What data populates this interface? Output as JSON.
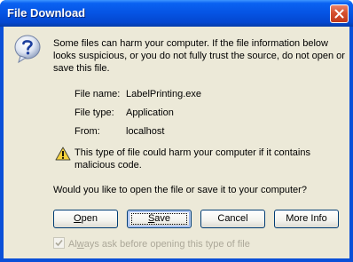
{
  "window": {
    "title": "File Download"
  },
  "icons": {
    "close": "close-icon",
    "question": "question-icon",
    "warning": "warning-icon",
    "checkmark": "checkmark-icon"
  },
  "message": {
    "intro": "Some files can harm your computer. If the file information below looks suspicious, or you do not fully trust the source, do not open or save this file."
  },
  "file_info": {
    "name_label": "File name:",
    "name_value": "LabelPrinting.exe",
    "type_label": "File type:",
    "type_value": "Application",
    "from_label": "From:",
    "from_value": "localhost"
  },
  "warning": {
    "text": "This type of file could harm your computer if it contains malicious code."
  },
  "question": "Would you like to open the file or save it to your computer?",
  "buttons": {
    "open_key": "O",
    "open_rest": "pen",
    "save_key": "S",
    "save_rest": "ave",
    "cancel": "Cancel",
    "more_info": "More Info"
  },
  "checkbox": {
    "label_pre": "Al",
    "label_key": "w",
    "label_post": "ays ask before opening this type of file",
    "checked": true,
    "disabled": true
  },
  "colors": {
    "title_bar": "#0553e3",
    "client_bg": "#ece9d8",
    "close_button": "#d5502f",
    "button_border": "#003c74"
  }
}
